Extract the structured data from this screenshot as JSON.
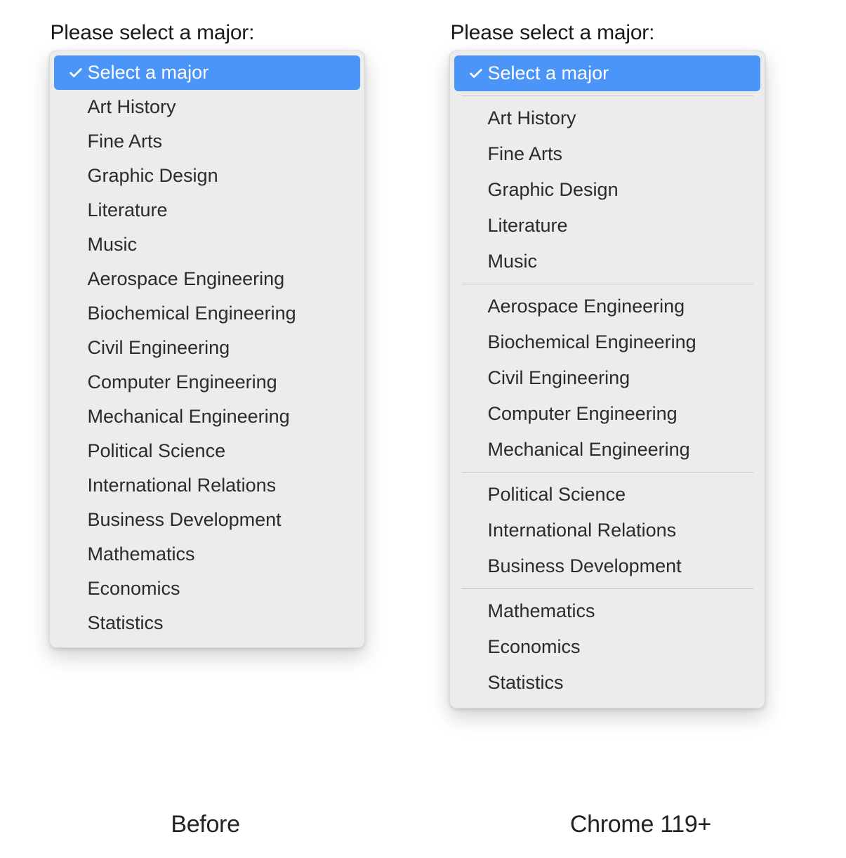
{
  "left": {
    "prompt": "Please select a major:",
    "caption": "Before",
    "selectedLabel": "Select a major",
    "items": [
      "Art History",
      "Fine Arts",
      "Graphic Design",
      "Literature",
      "Music",
      "Aerospace Engineering",
      "Biochemical Engineering",
      "Civil Engineering",
      "Computer Engineering",
      "Mechanical Engineering",
      "Political Science",
      "International Relations",
      "Business Development",
      "Mathematics",
      "Economics",
      "Statistics"
    ]
  },
  "right": {
    "prompt": "Please select a major:",
    "caption": "Chrome 119+",
    "selectedLabel": "Select a major",
    "groups": [
      [
        "Art History",
        "Fine Arts",
        "Graphic Design",
        "Literature",
        "Music"
      ],
      [
        "Aerospace Engineering",
        "Biochemical Engineering",
        "Civil Engineering",
        "Computer Engineering",
        "Mechanical Engineering"
      ],
      [
        "Political Science",
        "International Relations",
        "Business Development"
      ],
      [
        "Mathematics",
        "Economics",
        "Statistics"
      ]
    ]
  },
  "colors": {
    "highlight": "#4a95f7",
    "menuBg": "#ececec",
    "divider": "#c9c9c9"
  }
}
